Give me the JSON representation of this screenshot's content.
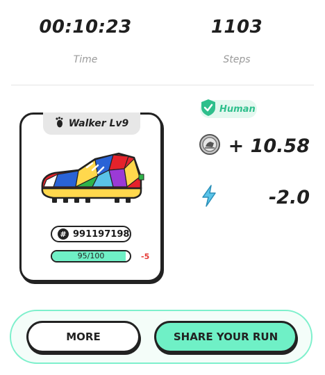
{
  "stats": {
    "time": {
      "value": "00:10:23",
      "label": "Time"
    },
    "steps": {
      "value": "1103",
      "label": "Steps"
    }
  },
  "sneaker": {
    "name": "Walker Lv9",
    "id": "991197198",
    "durability": {
      "text": "95/100",
      "fraction": 0.95,
      "delta": "-5"
    }
  },
  "badge": {
    "label": "Human",
    "icon": "shield-check-icon"
  },
  "reward": {
    "value": "+ 10.58",
    "icon": "coin-icon"
  },
  "energy": {
    "value": "-2.0",
    "icon": "lightning-icon"
  },
  "actions": {
    "more_label": "MORE",
    "share_label": "SHARE YOUR RUN"
  },
  "colors": {
    "accent": "#6ff0c6",
    "badge_text": "#2ebf8c",
    "negative": "#e53935"
  }
}
